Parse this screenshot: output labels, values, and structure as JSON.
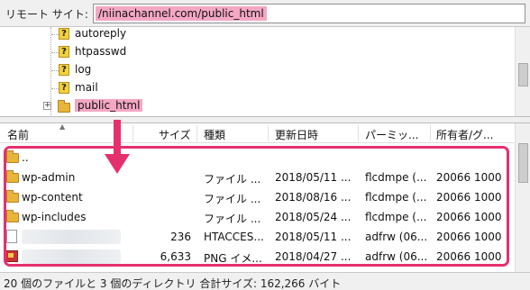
{
  "address": {
    "label": "リモート サイト:",
    "value": "/niinachannel.com/public_html"
  },
  "tree": {
    "items": [
      {
        "label": "autoreply",
        "icon": "unknown-question-icon"
      },
      {
        "label": "htpasswd",
        "icon": "unknown-question-icon"
      },
      {
        "label": "log",
        "icon": "unknown-question-icon"
      },
      {
        "label": "mail",
        "icon": "unknown-question-icon"
      },
      {
        "label": "public_html",
        "icon": "folder-icon",
        "expand": "+"
      }
    ]
  },
  "list": {
    "headers": {
      "name": "名前",
      "size": "サイズ",
      "type": "種類",
      "date": "更新日時",
      "perm": "パーミッ...",
      "owner": "所有者/グ..."
    },
    "rows": [
      {
        "name": "..",
        "size": "",
        "type": "",
        "date": "",
        "perm": "",
        "owner": "",
        "icon": "folder-icon"
      },
      {
        "name": "wp-admin",
        "size": "",
        "type": "ファイル ...",
        "date": "2018/05/11 ...",
        "perm": "flcdmpe (...",
        "owner": "20066 1000",
        "icon": "folder-icon"
      },
      {
        "name": "wp-content",
        "size": "",
        "type": "ファイル ...",
        "date": "2018/08/16 ...",
        "perm": "flcdmpe (...",
        "owner": "20066 1000",
        "icon": "folder-icon"
      },
      {
        "name": "wp-includes",
        "size": "",
        "type": "ファイル ...",
        "date": "2018/05/24 ...",
        "perm": "flcdmpe (...",
        "owner": "20066 1000",
        "icon": "folder-icon"
      },
      {
        "name": "",
        "size": "236",
        "type": "HTACCES...",
        "date": "2018/05/11 ...",
        "perm": "adfrw (06...",
        "owner": "20066 1000",
        "icon": "file-icon"
      },
      {
        "name": "",
        "size": "6,633",
        "type": "PNG イメ...",
        "date": "2018/04/27 ...",
        "perm": "adfrw (06...",
        "owner": "20066 1000",
        "icon": "png-image-icon"
      }
    ]
  },
  "status": {
    "text": "20 個のファイルと 3 個のディレクトリ 合計サイズ: 162,266 バイト"
  },
  "colors": {
    "highlight": "#f4a7c3",
    "annotation": "#e6306e",
    "folder": "#e8b43a"
  }
}
